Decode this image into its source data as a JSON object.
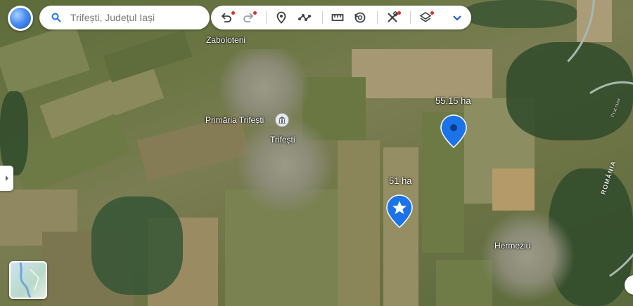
{
  "search": {
    "placeholder": "Trifești, Județul Iași"
  },
  "toolbar": {
    "items": [
      "undo-icon",
      "redo-icon",
      "pin-icon",
      "path-icon",
      "ruler-icon",
      "history-icon",
      "tools-icon",
      "layers-icon",
      "chevron-down-icon"
    ]
  },
  "map": {
    "places": {
      "zaboloteni": "Zaboloteni",
      "primaria": "Primăria Trifești",
      "trifesti": "Trifești",
      "hermeziu": "Hermeziu"
    },
    "areas": {
      "north": "55.15 ha",
      "south": "51 ha"
    },
    "border_label": "ROMÂNIA",
    "river_label": "Prut river"
  },
  "colors": {
    "accent": "#1a73e8",
    "pin": "#1a73e8",
    "notification": "#d93025"
  }
}
